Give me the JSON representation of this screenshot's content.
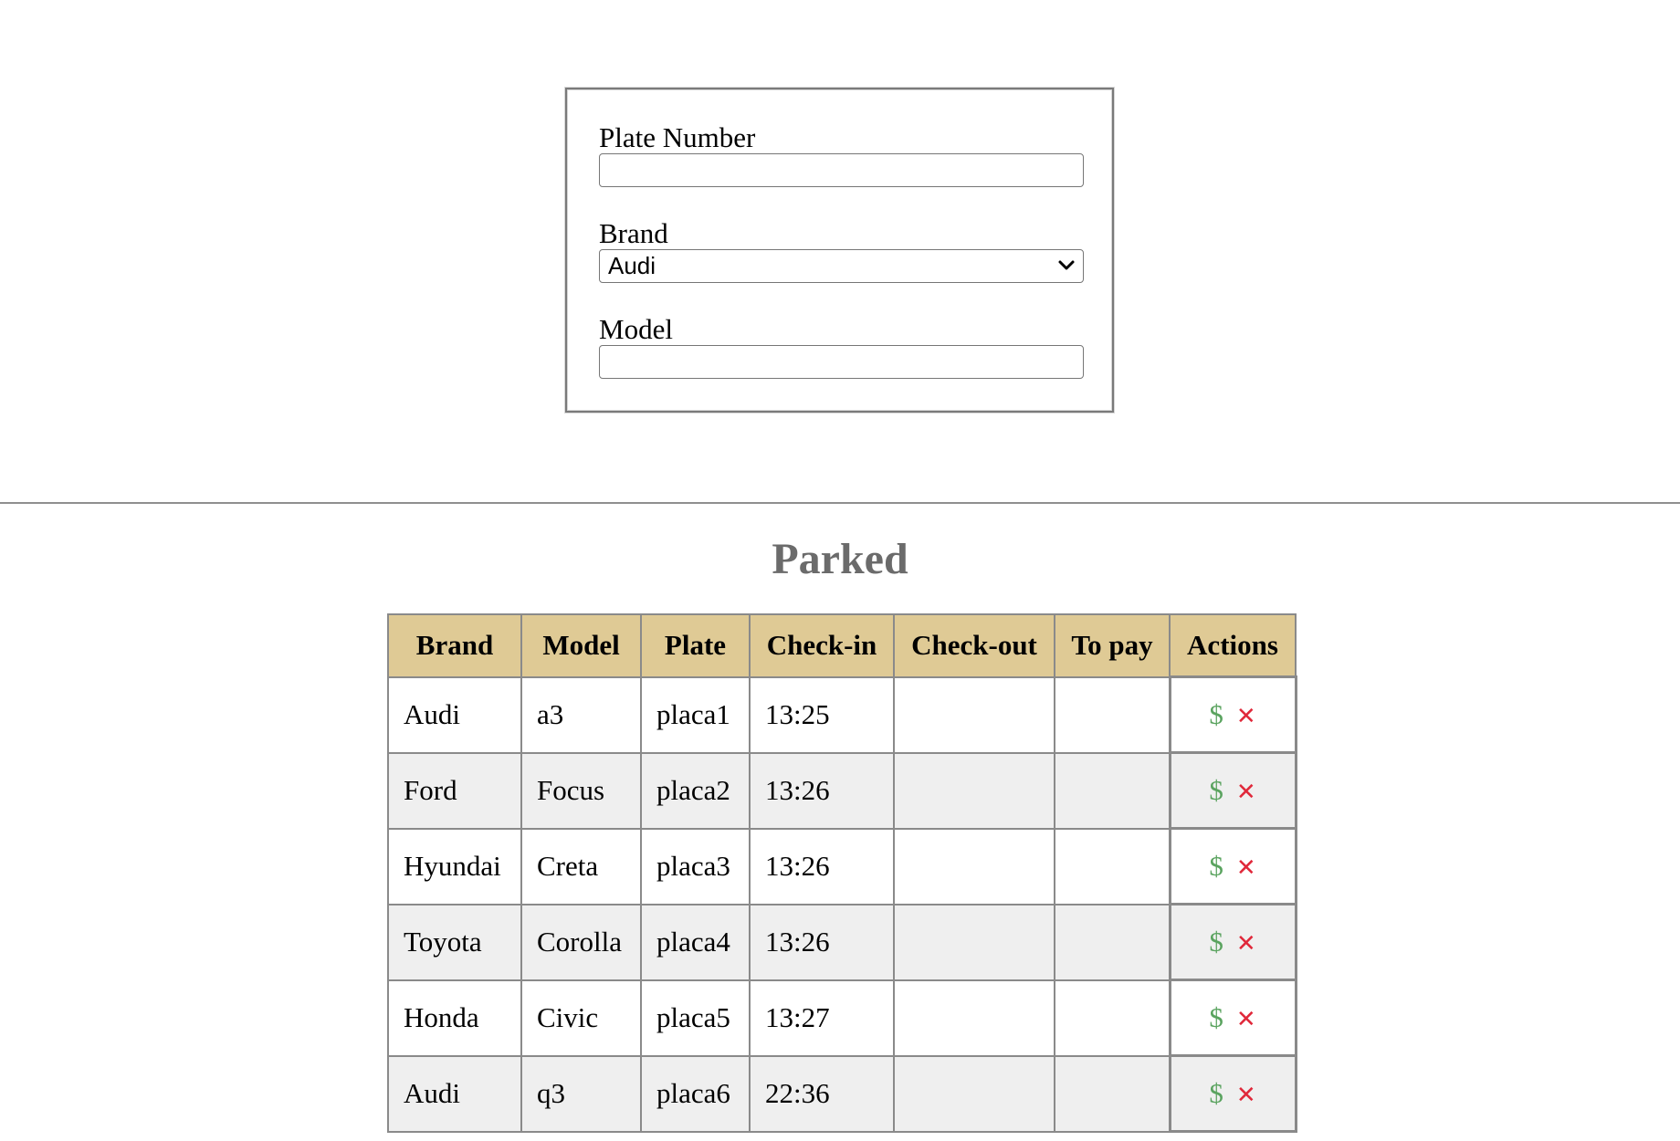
{
  "form": {
    "plate_label": "Plate Number",
    "plate_value": "",
    "brand_label": "Brand",
    "brand_selected": "Audi",
    "model_label": "Model",
    "model_value": ""
  },
  "parked": {
    "title": "Parked",
    "columns": [
      "Brand",
      "Model",
      "Plate",
      "Check-in",
      "Check-out",
      "To pay",
      "Actions"
    ],
    "rows": [
      {
        "brand": "Audi",
        "model": "a3",
        "plate": "placa1",
        "checkin": "13:25",
        "checkout": "",
        "topay": ""
      },
      {
        "brand": "Ford",
        "model": "Focus",
        "plate": "placa2",
        "checkin": "13:26",
        "checkout": "",
        "topay": ""
      },
      {
        "brand": "Hyundai",
        "model": "Creta",
        "plate": "placa3",
        "checkin": "13:26",
        "checkout": "",
        "topay": ""
      },
      {
        "brand": "Toyota",
        "model": "Corolla",
        "plate": "placa4",
        "checkin": "13:26",
        "checkout": "",
        "topay": ""
      },
      {
        "brand": "Honda",
        "model": "Civic",
        "plate": "placa5",
        "checkin": "13:27",
        "checkout": "",
        "topay": ""
      },
      {
        "brand": "Audi",
        "model": "q3",
        "plate": "placa6",
        "checkin": "22:36",
        "checkout": "",
        "topay": ""
      }
    ],
    "actions": {
      "pay_icon": "$",
      "delete_icon": "✕"
    }
  },
  "colors": {
    "header_bg": "#dfca95",
    "pay_icon": "#5aa35f",
    "delete_icon": "#e0283a",
    "title": "#6b6b6b"
  },
  "icons": {
    "pay": "dollar-icon",
    "delete": "close-icon",
    "select": "chevron-down-icon"
  }
}
